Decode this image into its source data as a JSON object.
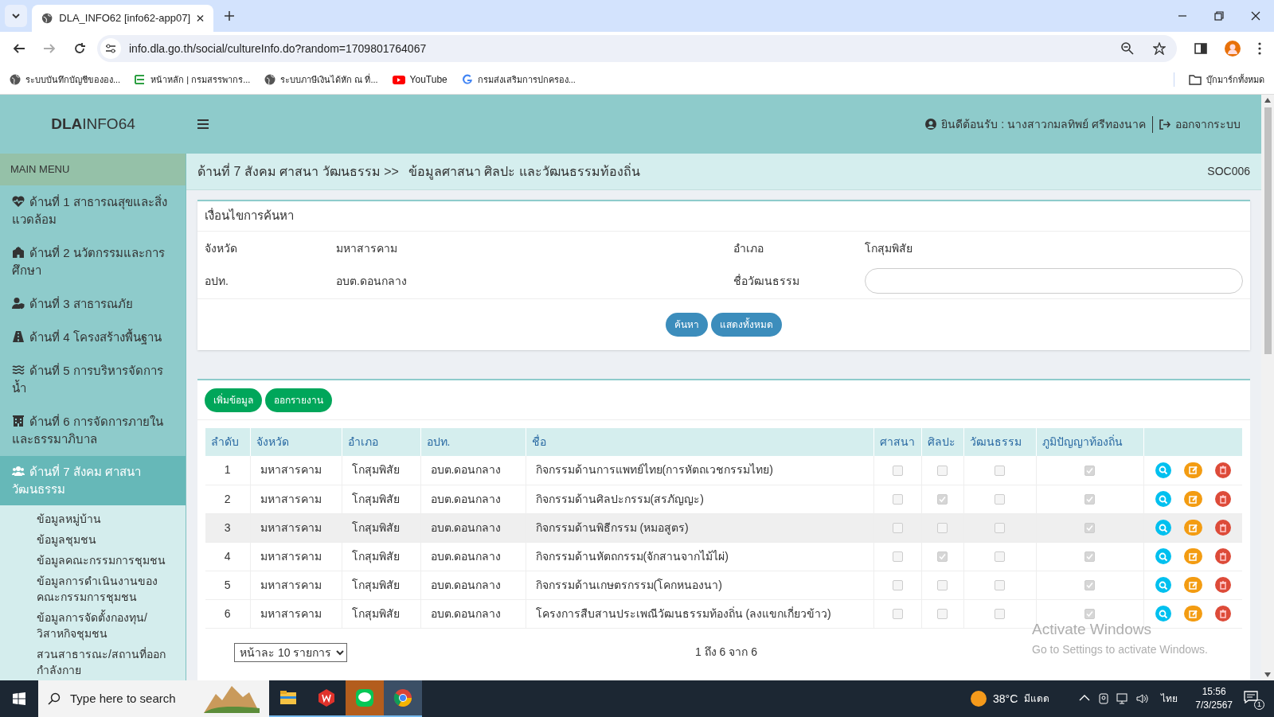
{
  "browser": {
    "tab_title": "DLA_INFO62 [info62-app07]",
    "url": "info.dla.go.th/social/cultureInfo.do?random=1709801764067",
    "bookmarks": [
      "ระบบบันทึกบัญชีขององ...",
      "หน้าหลัก | กรมสรรพากร...",
      "ระบบภาษีเงินได้หัก ณ ที่...",
      "YouTube",
      "กรมส่งเสริมการปกครอง..."
    ],
    "all_bookmarks": "บุ๊กมาร์กทั้งหมด"
  },
  "header": {
    "logo_bold": "DLA",
    "logo_rest": "INFO64",
    "welcome": "ยินดีต้อนรับ : นางสาวกมลทิพย์ ศรีทองนาค",
    "logout": "ออกจากระบบ"
  },
  "sidebar": {
    "heading": "MAIN MENU",
    "items": [
      {
        "label": "ด้านที่ 1 สาธารณสุขและสิ่งแวดล้อม",
        "selected": false
      },
      {
        "label": "ด้านที่ 2 นวัตกรรมและการศึกษา",
        "selected": false
      },
      {
        "label": "ด้านที่ 3 สาธารณภัย",
        "selected": false
      },
      {
        "label": "ด้านที่ 4 โครงสร้างพื้นฐาน",
        "selected": false
      },
      {
        "label": "ด้านที่ 5 การบริหารจัดการน้ำ",
        "selected": false
      },
      {
        "label": "ด้านที่ 6 การจัดการภายในและธรรมาภิบาล",
        "selected": false
      },
      {
        "label": "ด้านที่ 7 สังคม ศาสนา วัฒนธรรม",
        "selected": true,
        "children": [
          "ข้อมูลหมู่บ้าน",
          "ข้อมูลชุมชน",
          "ข้อมูลคณะกรรมการชุมชน",
          "ข้อมูลการดำเนินงานของคณะกรรมการชุมชน",
          "ข้อมูลการจัดตั้งกองทุน/วิสาหกิจชุมชน",
          "สวนสาธารณะ/สถานที่ออกกำลังกาย"
        ]
      }
    ]
  },
  "breadcrumb": {
    "section": "ด้านที่ 7 สังคม ศาสนา วัฒนธรรม >>",
    "page": "ข้อมูลศาสนา ศิลปะ และวัฒนธรรมท้องถิ่น",
    "code": "SOC006"
  },
  "search": {
    "title": "เงื่อนไขการค้นหา",
    "fields": [
      {
        "label": "จังหวัด",
        "value": "มหาสารคาม"
      },
      {
        "label": "อำเภอ",
        "value": "โกสุมพิสัย"
      },
      {
        "label": "อปท.",
        "value": "อบต.ดอนกลาง"
      },
      {
        "label": "ชื่อวัฒนธรรม",
        "kind": "input"
      }
    ],
    "buttons": [
      "ค้นหา",
      "แสดงทั้งหมด"
    ]
  },
  "list": {
    "buttons": [
      "เพิ่มข้อมูล",
      "ออกรายงาน"
    ],
    "columns": [
      "ลำดับ",
      "จังหวัด",
      "อำเภอ",
      "อปท.",
      "ชื่อ",
      "ศาสนา",
      "ศิลปะ",
      "วัฒนธรรม",
      "ภูมิปัญญาท้องถิ่น"
    ],
    "rows": [
      {
        "cells": [
          "1",
          "มหาสารคาม",
          "โกสุมพิสัย",
          "อบต.ดอนกลาง",
          "กิจกรรมด้านการแพทย์ไทย(การหัตถเวชกรรมไทย)"
        ],
        "checks": [
          false,
          false,
          false,
          true
        ],
        "hovered": false
      },
      {
        "cells": [
          "2",
          "มหาสารคาม",
          "โกสุมพิสัย",
          "อบต.ดอนกลาง",
          "กิจกรรมด้านศิลปะกรรม(สรภัญญะ)"
        ],
        "checks": [
          false,
          true,
          false,
          true
        ],
        "hovered": false
      },
      {
        "cells": [
          "3",
          "มหาสารคาม",
          "โกสุมพิสัย",
          "อบต.ดอนกลาง",
          "กิจกรรมด้านพิธีกรรม (หมอสูตร)"
        ],
        "checks": [
          false,
          false,
          false,
          true
        ],
        "hovered": true
      },
      {
        "cells": [
          "4",
          "มหาสารคาม",
          "โกสุมพิสัย",
          "อบต.ดอนกลาง",
          "กิจกรรมด้านหัตถกรรม(จักสานจากไม้ไผ่)"
        ],
        "checks": [
          false,
          true,
          false,
          true
        ],
        "hovered": false
      },
      {
        "cells": [
          "5",
          "มหาสารคาม",
          "โกสุมพิสัย",
          "อบต.ดอนกลาง",
          "กิจกรรมด้านเกษตรกรรม(โคกหนองนา)"
        ],
        "checks": [
          false,
          false,
          false,
          true
        ],
        "hovered": false
      },
      {
        "cells": [
          "6",
          "มหาสารคาม",
          "โกสุมพิสัย",
          "อบต.ดอนกลาง",
          "โครงการสืบสานประเพณีวัฒนธรรมท้องถิ่น (ลงแขกเกี่ยวข้าว)"
        ],
        "checks": [
          false,
          false,
          false,
          true
        ],
        "hovered": false
      }
    ],
    "page_size": "หน้าละ 10 รายการ",
    "summary": "1 ถึง 6 จาก 6"
  },
  "activation": {
    "title": "Activate Windows",
    "text": "Go to Settings to activate Windows."
  },
  "taskbar": {
    "search_placeholder": "Type here to search",
    "temperature": "38°C",
    "weather": "มีแดด",
    "language": "ไทย",
    "time": "15:56",
    "date": "7/3/2567",
    "notifications": "1"
  }
}
